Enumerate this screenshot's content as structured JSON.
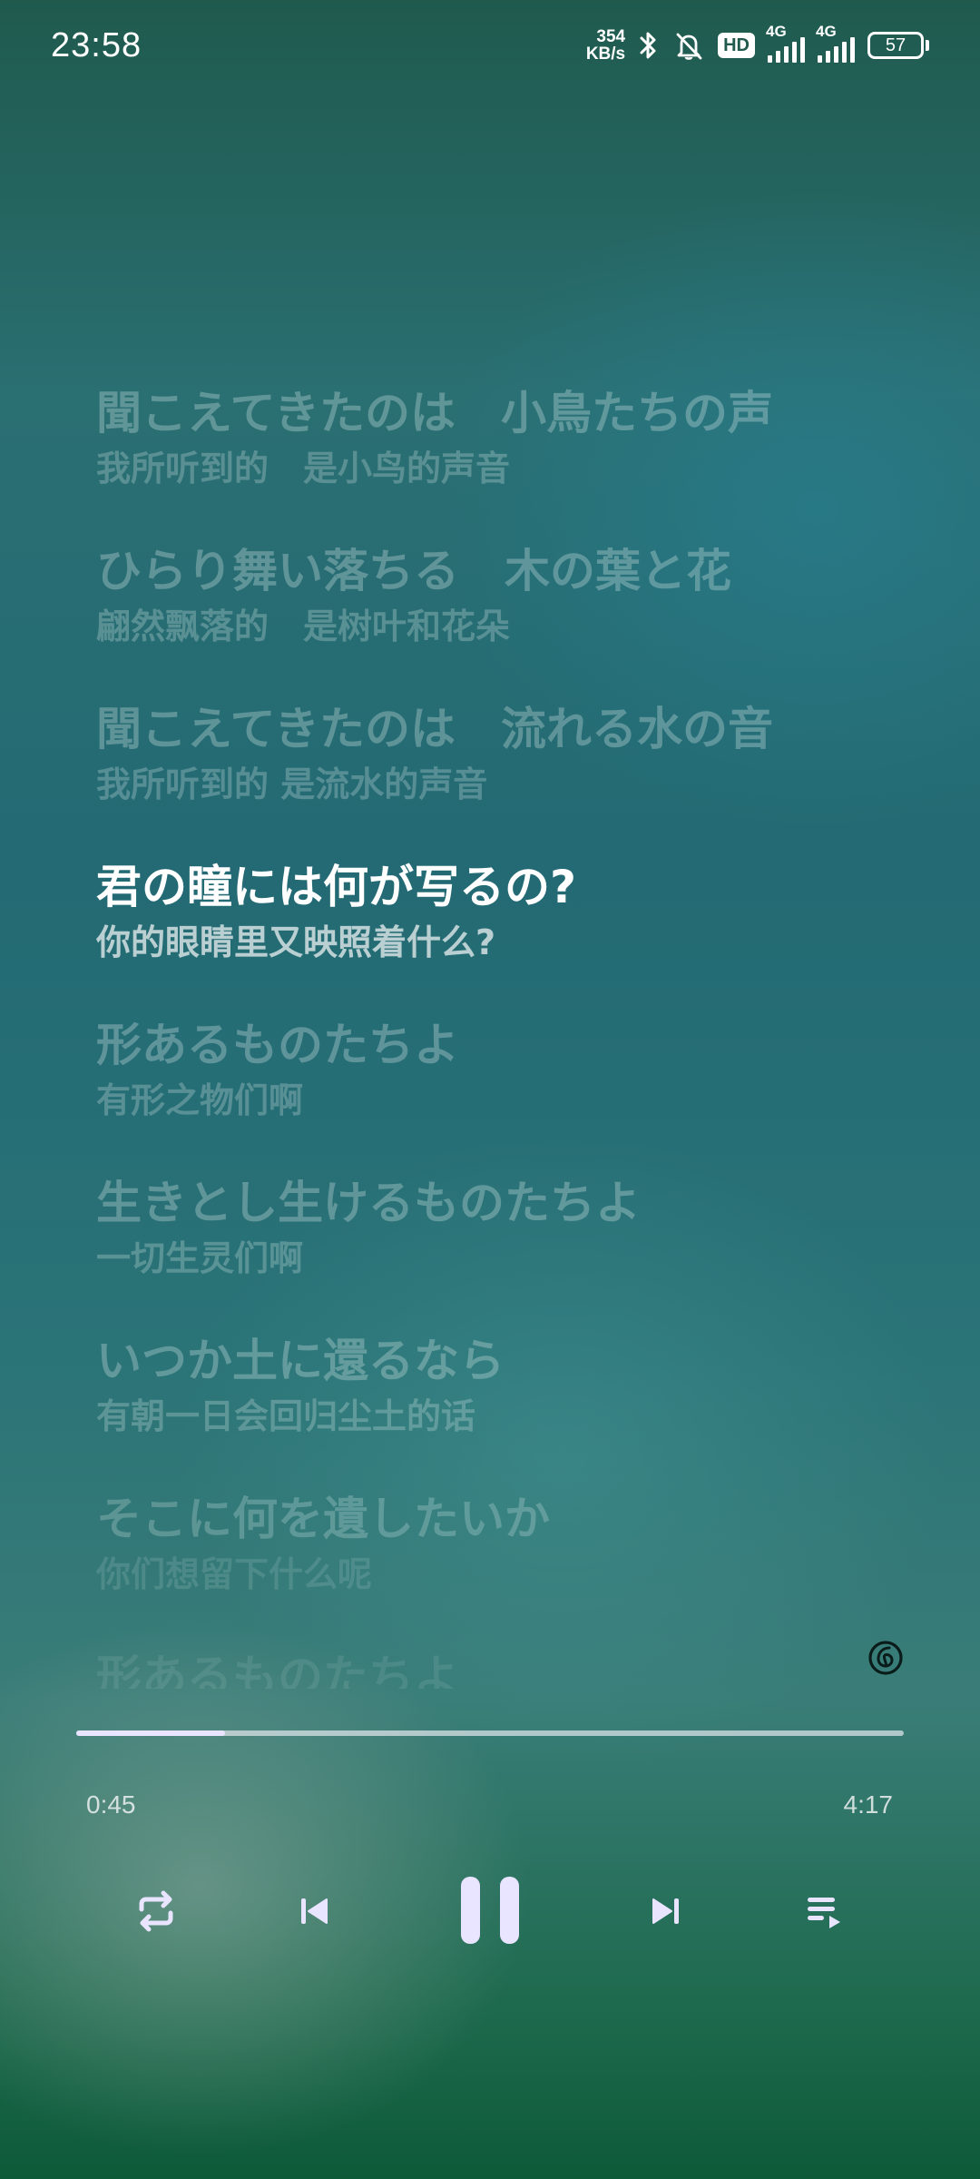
{
  "status_bar": {
    "time": "23:58",
    "net_speed_value": "354",
    "net_speed_unit": "KB/s",
    "hd_badge": "HD",
    "sim1_label": "4G",
    "sim2_label": "4G",
    "battery_level": "57",
    "icons": [
      "bluetooth-icon",
      "mute-icon",
      "hd-icon",
      "signal-icon",
      "signal-icon",
      "battery-icon"
    ]
  },
  "lyrics": [
    {
      "main": "聞こえてきたのは　小鳥たちの声",
      "sub": "我所听到的　是小鸟的声音"
    },
    {
      "main": "ひらり舞い落ちる　木の葉と花",
      "sub": "翩然飘落的　是树叶和花朵"
    },
    {
      "main": "聞こえてきたのは　流れる水の音",
      "sub": "我所听到的 是流水的声音"
    },
    {
      "main": "君の瞳には何が写るの?",
      "sub": "你的眼睛里又映照着什么?"
    },
    {
      "main": "形あるものたちよ",
      "sub": "有形之物们啊"
    },
    {
      "main": "生きとし生けるものたちよ",
      "sub": "一切生灵们啊"
    },
    {
      "main": "いつか土に還るなら",
      "sub": "有朝一日会回归尘土的话"
    },
    {
      "main": "そこに何を遺したいか",
      "sub": "你们想留下什么呢"
    },
    {
      "main": "形あるものたちよ",
      "sub": ""
    }
  ],
  "current_lyric_index": 3,
  "playback": {
    "elapsed": "0:45",
    "total": "4:17",
    "progress_fraction": 0.18
  },
  "controls": {
    "icons": [
      "repeat-icon",
      "previous-icon",
      "pause-icon",
      "next-icon",
      "playlist-icon"
    ],
    "state": "playing"
  },
  "colors": {
    "accent": "#e9e4ff",
    "text_active": "#ffffff",
    "background_top": "#1f5a4d",
    "background_bottom": "#0d5a39"
  }
}
